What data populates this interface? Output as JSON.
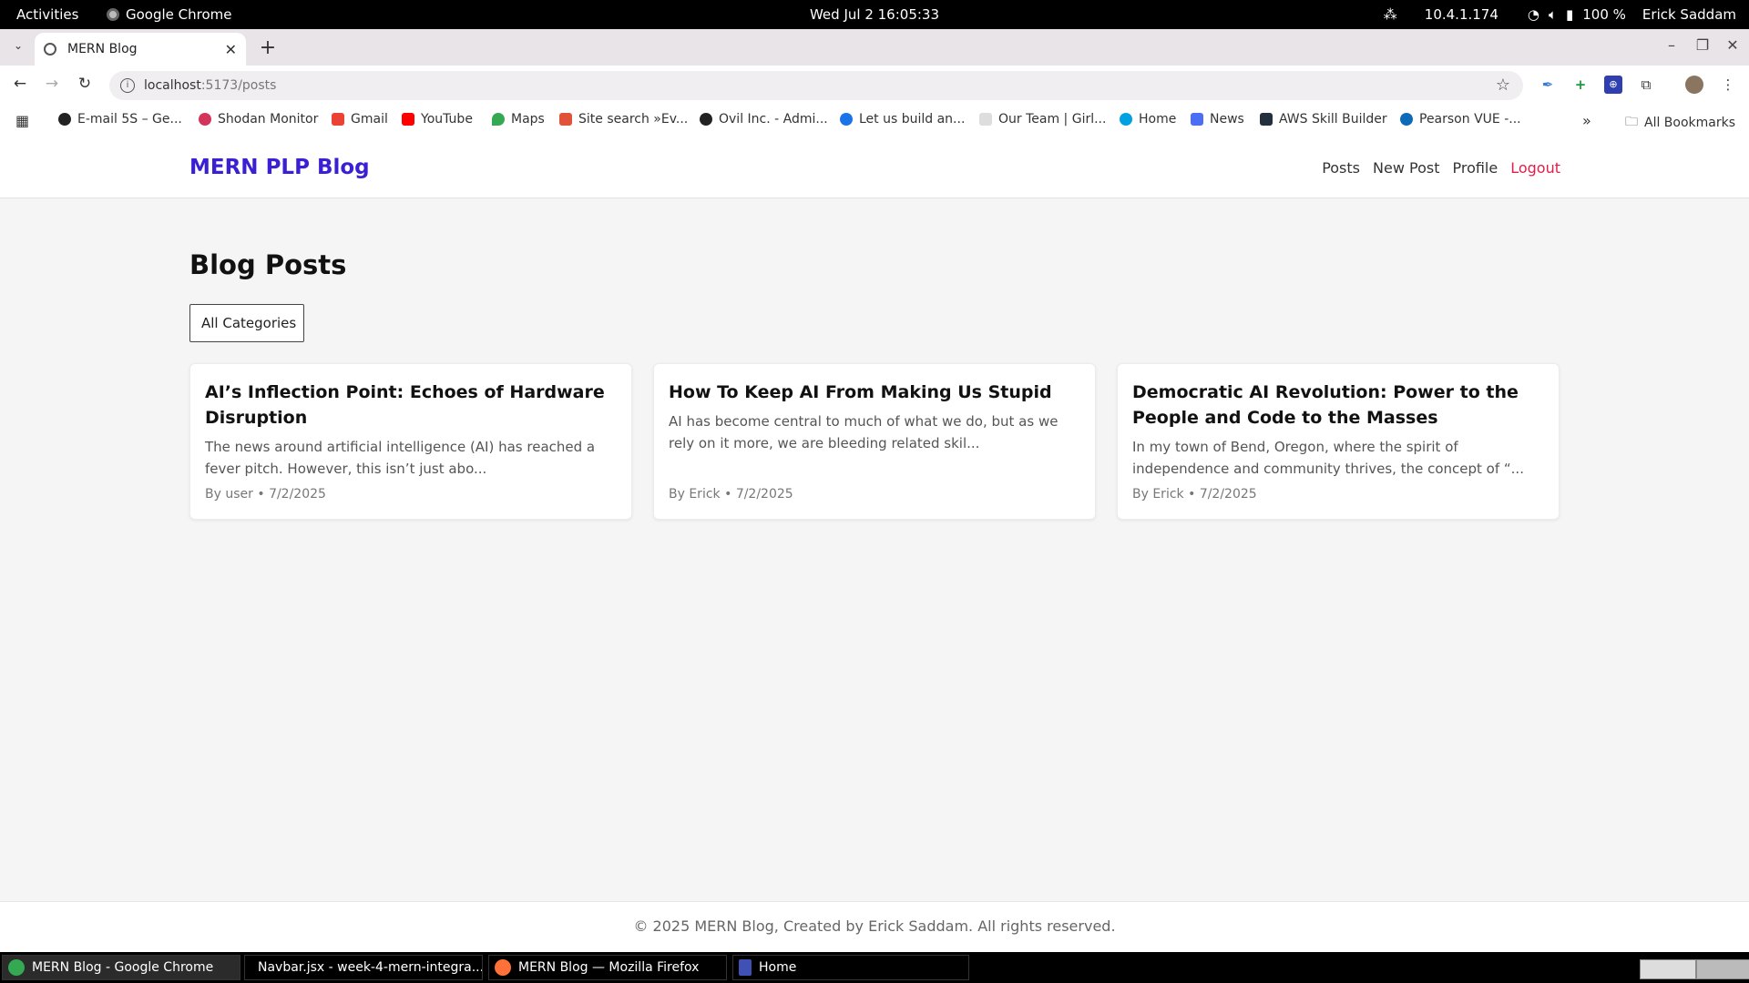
{
  "topbar": {
    "activities": "Activities",
    "app_name": "Google Chrome",
    "clock": "Wed Jul 2  16:05:33",
    "ip": "10.4.1.174",
    "battery": "100 %",
    "user": "Erick Saddam"
  },
  "browser": {
    "tab_title": "MERN Blog",
    "url_host": "localhost",
    "url_path": ":5173/posts",
    "bookmarks": [
      {
        "label": "E-mail 5S – Ge...",
        "color": "#222222"
      },
      {
        "label": "Shodan Monitor",
        "color": "#d4345a"
      },
      {
        "label": "Gmail",
        "color": "#ea4335"
      },
      {
        "label": "YouTube",
        "color": "#ff0000"
      },
      {
        "label": "Maps",
        "color": "#34a853"
      },
      {
        "label": "Site search »Ev...",
        "color": "#e0523a"
      },
      {
        "label": "Ovil Inc. - Admi...",
        "color": "#222222"
      },
      {
        "label": "Let us build an...",
        "color": "#1a73e8"
      },
      {
        "label": "Our Team | Girl...",
        "color": "#999999"
      },
      {
        "label": "Home",
        "color": "#00a1e0"
      },
      {
        "label": "News",
        "color": "#4c6ef5"
      },
      {
        "label": "AWS Skill Builder",
        "color": "#232f3e"
      },
      {
        "label": "Pearson VUE -...",
        "color": "#0d6ab8"
      }
    ],
    "all_bookmarks": "All Bookmarks"
  },
  "site": {
    "brand": "MERN PLP Blog",
    "nav": {
      "posts": "Posts",
      "new_post": "New Post",
      "profile": "Profile",
      "logout": "Logout"
    },
    "heading": "Blog Posts",
    "category_select": "All Categories",
    "posts": [
      {
        "title": "AI’s Inflection Point: Echoes of Hardware Disruption",
        "excerpt": "The news around artificial intelligence (AI) has reached a fever pitch. However, this isn’t just abo...",
        "author": "By user",
        "date": "7/2/2025"
      },
      {
        "title": "How To Keep AI From Making Us Stupid",
        "excerpt": "AI has become central to much of what we do, but as we rely on it more, we are bleeding related skil...",
        "author": "By Erick",
        "date": "7/2/2025"
      },
      {
        "title": "Democratic AI Revolution: Power to the People and Code to the Masses",
        "excerpt": "In my town of Bend, Oregon, where the spirit of independence and community thrives, the concept of “...",
        "author": "By Erick",
        "date": "7/2/2025"
      }
    ],
    "footer": "© 2025 MERN Blog, Created by Erick Saddam. All rights reserved."
  },
  "taskbar": {
    "items": [
      {
        "label": "MERN Blog - Google Chrome",
        "color": "#34a853"
      },
      {
        "label": "Navbar.jsx - week-4-mern-integra...",
        "color": "#1e88e5"
      },
      {
        "label": "MERN Blog — Mozilla Firefox",
        "color": "#ff7139"
      },
      {
        "label": "Home",
        "color": "#3f51b5"
      }
    ]
  },
  "colors": {
    "brand": "#3b1fd4",
    "logout": "#e11d48"
  }
}
